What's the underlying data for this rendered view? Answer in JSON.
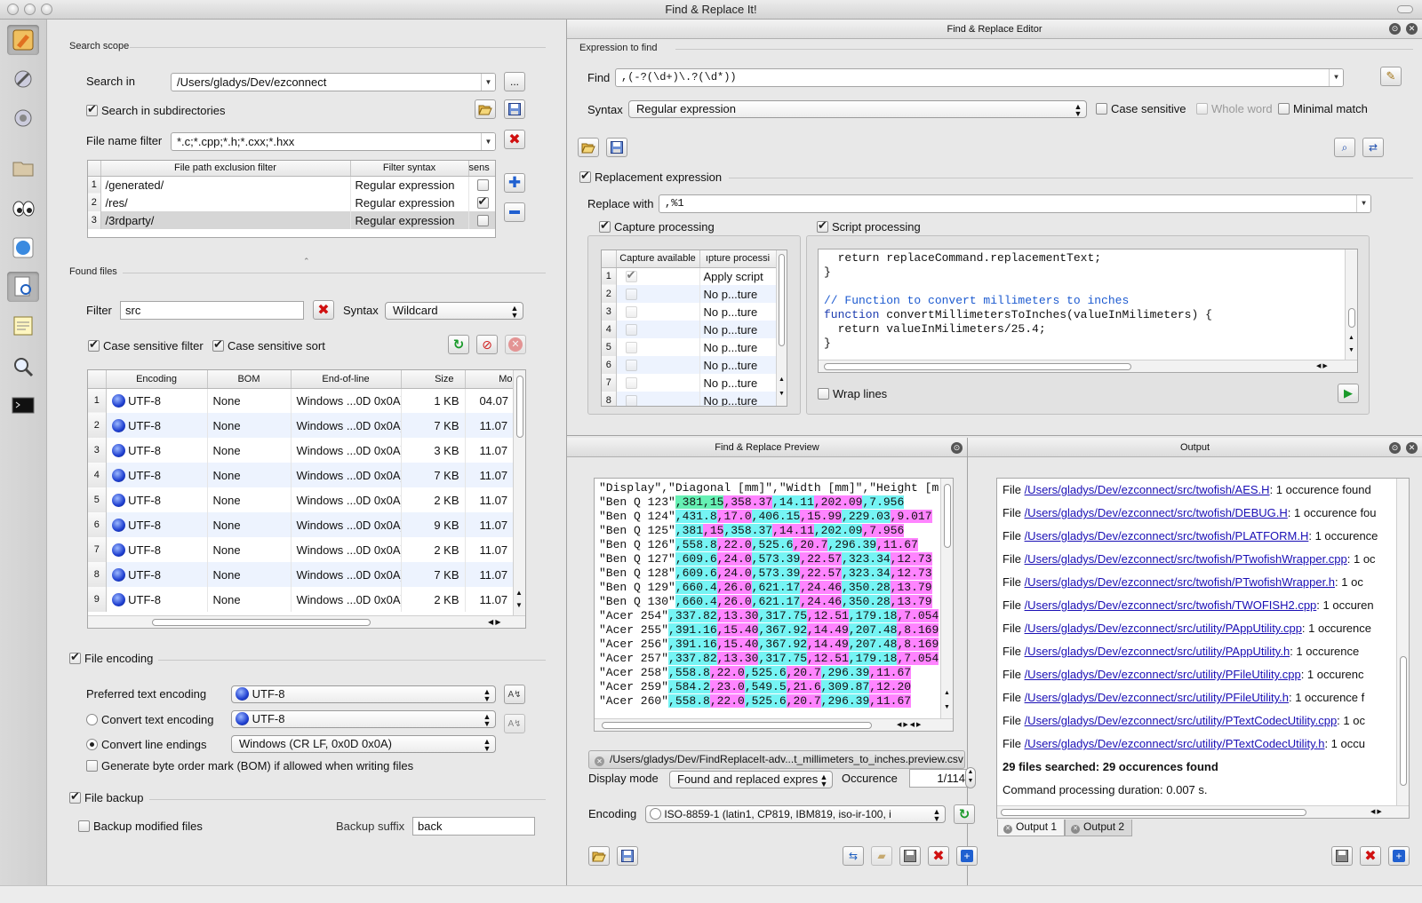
{
  "window": {
    "title": "Find & Replace It!"
  },
  "colors": {
    "highlight_green": "#66f0b4",
    "highlight_magenta": "#ff84ff",
    "highlight_cyan": "#75f4f4",
    "link": "#1a0fb5"
  },
  "toolbar": {
    "icons": [
      "find-replace-icon",
      "tools-icon",
      "settings-icon",
      "folder-icon",
      "eyes-icon",
      "globe-icon",
      "search-doc-icon",
      "notepad-icon",
      "magnifier-icon",
      "terminal-icon"
    ]
  },
  "search_scope": {
    "title": "Search scope",
    "search_in_label": "Search in",
    "search_in_value": "/Users/gladys/Dev/ezconnect",
    "browse_label": "...",
    "subdirs_label": "Search in subdirectories",
    "file_filter_label": "File name filter",
    "file_filter_value": "*.c;*.cpp;*.h;*.cxx;*.hxx",
    "exclusion": {
      "headers": [
        "File path exclusion filter",
        "Filter syntax",
        "sens"
      ],
      "rows": [
        {
          "n": "1",
          "path": "/generated/",
          "syntax": "Regular expression",
          "sens": false
        },
        {
          "n": "2",
          "path": "/res/",
          "syntax": "Regular expression",
          "sens": true
        },
        {
          "n": "3",
          "path": "/3rdparty/",
          "syntax": "Regular expression",
          "sens": false
        }
      ]
    }
  },
  "found_files": {
    "title": "Found files",
    "filter_label": "Filter",
    "filter_value": "src",
    "syntax_label": "Syntax",
    "syntax_value": "Wildcard",
    "case_filter_label": "Case sensitive filter",
    "case_sort_label": "Case sensitive sort",
    "headers": [
      "Encoding",
      "BOM",
      "End-of-line",
      "Size",
      "Mo"
    ],
    "rows": [
      {
        "n": "1",
        "enc": "UTF-8",
        "bom": "None",
        "eol": "Windows ...0D 0x0A)",
        "size": "1 KB",
        "mod": "04.07"
      },
      {
        "n": "2",
        "enc": "UTF-8",
        "bom": "None",
        "eol": "Windows ...0D 0x0A)",
        "size": "7 KB",
        "mod": "11.07"
      },
      {
        "n": "3",
        "enc": "UTF-8",
        "bom": "None",
        "eol": "Windows ...0D 0x0A)",
        "size": "3 KB",
        "mod": "11.07"
      },
      {
        "n": "4",
        "enc": "UTF-8",
        "bom": "None",
        "eol": "Windows ...0D 0x0A)",
        "size": "7 KB",
        "mod": "11.07"
      },
      {
        "n": "5",
        "enc": "UTF-8",
        "bom": "None",
        "eol": "Windows ...0D 0x0A)",
        "size": "2 KB",
        "mod": "11.07"
      },
      {
        "n": "6",
        "enc": "UTF-8",
        "bom": "None",
        "eol": "Windows ...0D 0x0A)",
        "size": "9 KB",
        "mod": "11.07"
      },
      {
        "n": "7",
        "enc": "UTF-8",
        "bom": "None",
        "eol": "Windows ...0D 0x0A)",
        "size": "2 KB",
        "mod": "11.07"
      },
      {
        "n": "8",
        "enc": "UTF-8",
        "bom": "None",
        "eol": "Windows ...0D 0x0A)",
        "size": "7 KB",
        "mod": "11.07"
      },
      {
        "n": "9",
        "enc": "UTF-8",
        "bom": "None",
        "eol": "Windows ...0D 0x0A)",
        "size": "2 KB",
        "mod": "11.07"
      }
    ]
  },
  "file_encoding": {
    "title": "File encoding",
    "preferred_label": "Preferred text encoding",
    "preferred_value": "UTF-8",
    "convert_label": "Convert text encoding",
    "convert_value": "UTF-8",
    "line_endings_label": "Convert line endings",
    "line_endings_value": "Windows (CR LF, 0x0D 0x0A)",
    "bom_label": "Generate byte order mark (BOM) if allowed when writing files"
  },
  "file_backup": {
    "title": "File backup",
    "backup_label": "Backup modified files",
    "suffix_label": "Backup suffix",
    "suffix_value": "back"
  },
  "editor": {
    "title": "Find & Replace Editor",
    "expr_title": "Expression to find",
    "find_label": "Find",
    "find_value": ",(-?(\\d+)\\.?(\\d*))",
    "syntax_label": "Syntax",
    "syntax_value": "Regular expression",
    "case_label": "Case sensitive",
    "whole_label": "Whole word",
    "minimal_label": "Minimal match",
    "replacement_label": "Replacement expression",
    "replace_with_label": "Replace with",
    "replace_with_value": ",%1",
    "capture_label": "Capture processing",
    "script_label": "Script processing",
    "capture_headers": [
      "Capture available",
      "ıpture processi"
    ],
    "capture_rows": [
      {
        "n": "1",
        "on": true,
        "proc": "Apply script"
      },
      {
        "n": "2",
        "on": false,
        "proc": "No p...ture"
      },
      {
        "n": "3",
        "on": false,
        "proc": "No p...ture"
      },
      {
        "n": "4",
        "on": false,
        "proc": "No p...ture"
      },
      {
        "n": "5",
        "on": false,
        "proc": "No p...ture"
      },
      {
        "n": "6",
        "on": false,
        "proc": "No p...ture"
      },
      {
        "n": "7",
        "on": false,
        "proc": "No p...ture"
      },
      {
        "n": "8",
        "on": false,
        "proc": "No p...ture"
      }
    ],
    "script_lines": [
      {
        "kw": "",
        "text": "  return replaceCommand.replacementText;"
      },
      {
        "kw": "",
        "text": "}"
      },
      {
        "kw": "",
        "text": ""
      },
      {
        "kw": "comment",
        "text": "// Function to convert millimeters to inches"
      },
      {
        "kw": "function",
        "text": " convertMillimetersToInches(valueInMilimeters) {"
      },
      {
        "kw": "",
        "text": "  return valueInMilimeters/25.4;"
      },
      {
        "kw": "",
        "text": "}"
      }
    ],
    "wrap_label": "Wrap lines"
  },
  "preview": {
    "title": "Find & Replace Preview",
    "header_line": "\"Display\",\"Diagonal [mm]\",\"Width [mm]\",\"Height [m",
    "lines": [
      {
        "name": "\"Ben Q 123\"",
        "vals": [
          ",381,15",
          ",358.37",
          ",14.11",
          ",202.09",
          ",7.956"
        ]
      },
      {
        "name": "\"Ben Q 124\"",
        "vals": [
          ",431.8",
          ",17.0",
          ",406.15",
          ",15.99",
          ",229.03",
          ",9.017"
        ]
      },
      {
        "name": "\"Ben Q 125\"",
        "vals": [
          ",381",
          ",15",
          ",358.37",
          ",14.11",
          ",202.09",
          ",7.956"
        ]
      },
      {
        "name": "\"Ben Q 126\"",
        "vals": [
          ",558.8",
          ",22.0",
          ",525.6",
          ",20.7",
          ",296.39",
          ",11.67"
        ]
      },
      {
        "name": "\"Ben Q 127\"",
        "vals": [
          ",609.6",
          ",24.0",
          ",573.39",
          ",22.57",
          ",323.34",
          ",12.73"
        ]
      },
      {
        "name": "\"Ben Q 128\"",
        "vals": [
          ",609.6",
          ",24.0",
          ",573.39",
          ",22.57",
          ",323.34",
          ",12.73"
        ]
      },
      {
        "name": "\"Ben Q 129\"",
        "vals": [
          ",660.4",
          ",26.0",
          ",621.17",
          ",24.46",
          ",350.28",
          ",13.79"
        ]
      },
      {
        "name": "\"Ben Q 130\"",
        "vals": [
          ",660.4",
          ",26.0",
          ",621.17",
          ",24.46",
          ",350.28",
          ",13.79"
        ]
      },
      {
        "name": "\"Acer 254\"",
        "vals": [
          ",337.82",
          ",13.30",
          ",317.75",
          ",12.51",
          ",179.18",
          ",7.054"
        ]
      },
      {
        "name": "\"Acer 255\"",
        "vals": [
          ",391.16",
          ",15.40",
          ",367.92",
          ",14.49",
          ",207.48",
          ",8.169"
        ]
      },
      {
        "name": "\"Acer 256\"",
        "vals": [
          ",391.16",
          ",15.40",
          ",367.92",
          ",14.49",
          ",207.48",
          ",8.169"
        ]
      },
      {
        "name": "\"Acer 257\"",
        "vals": [
          ",337.82",
          ",13.30",
          ",317.75",
          ",12.51",
          ",179.18",
          ",7.054"
        ]
      },
      {
        "name": "\"Acer 258\"",
        "vals": [
          ",558.8",
          ",22.0",
          ",525.6",
          ",20.7",
          ",296.39",
          ",11.67"
        ]
      },
      {
        "name": "\"Acer 259\"",
        "vals": [
          ",584.2",
          ",23.0",
          ",549.5",
          ",21.6",
          ",309.87",
          ",12.20"
        ]
      },
      {
        "name": "\"Acer 260\"",
        "vals": [
          ",558.8",
          ",22.0",
          ",525.6",
          ",20.7",
          ",296.39",
          ",11.67"
        ]
      }
    ],
    "file_tab": "/Users/gladys/Dev/FindReplaceIt-adv...t_millimeters_to_inches.preview.csv",
    "display_mode_label": "Display mode",
    "display_mode_value": "Found and replaced expres",
    "occurence_label": "Occurence",
    "occurence_value": "1/114",
    "encoding_label": "Encoding",
    "encoding_value": "ISO-8859-1 (latin1, CP819, IBM819, iso-ir-100, i"
  },
  "output": {
    "title": "Output",
    "lines": [
      {
        "path": "/Users/gladys/Dev/ezconnect/src/twofish/AES.H",
        "suffix": ": 1 occurence found"
      },
      {
        "path": "/Users/gladys/Dev/ezconnect/src/twofish/DEBUG.H",
        "suffix": ": 1 occurence fou"
      },
      {
        "path": "/Users/gladys/Dev/ezconnect/src/twofish/PLATFORM.H",
        "suffix": ": 1 occurence"
      },
      {
        "path": "/Users/gladys/Dev/ezconnect/src/twofish/PTwofishWrapper.cpp",
        "suffix": ": 1 oc"
      },
      {
        "path": "/Users/gladys/Dev/ezconnect/src/twofish/PTwofishWrapper.h",
        "suffix": ": 1 oc"
      },
      {
        "path": "/Users/gladys/Dev/ezconnect/src/twofish/TWOFISH2.cpp",
        "suffix": ": 1 occuren"
      },
      {
        "path": "/Users/gladys/Dev/ezconnect/src/utility/PAppUtility.cpp",
        "suffix": ": 1 occurence"
      },
      {
        "path": "/Users/gladys/Dev/ezconnect/src/utility/PAppUtility.h",
        "suffix": ": 1 occurence"
      },
      {
        "path": "/Users/gladys/Dev/ezconnect/src/utility/PFileUtility.cpp",
        "suffix": ": 1 occurenc"
      },
      {
        "path": "/Users/gladys/Dev/ezconnect/src/utility/PFileUtility.h",
        "suffix": ": 1 occurence f"
      },
      {
        "path": "/Users/gladys/Dev/ezconnect/src/utility/PTextCodecUtility.cpp",
        "suffix": ": 1 oc"
      },
      {
        "path": "/Users/gladys/Dev/ezconnect/src/utility/PTextCodecUtility.h",
        "suffix": ": 1 occu"
      }
    ],
    "file_prefix": "File ",
    "summary": "29 files searched: 29 occurences found",
    "duration": "Command processing duration: 0.007 s.",
    "tabs": [
      "Output 1",
      "Output 2"
    ]
  }
}
